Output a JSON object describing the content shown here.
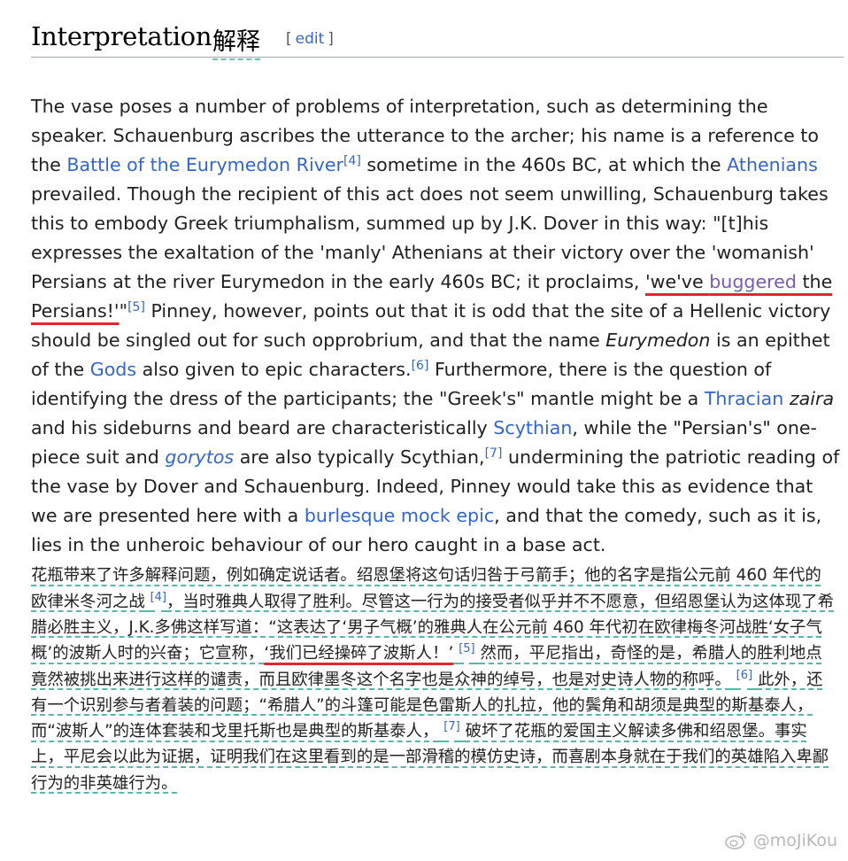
{
  "heading": {
    "title": "Interpretation",
    "title_cn": "解释",
    "edit_open": "[",
    "edit_label": "edit",
    "edit_close": "]"
  },
  "en": {
    "t1": "The vase poses a number of problems of interpretation, such as determining the speaker. Schauenburg ascribes the utterance to the archer; his name is a reference to the ",
    "link_battle": "Battle of the Eurymedon River",
    "ref4": "[4]",
    "t2": " sometime in the 460s BC, at which the ",
    "link_athenians": "Athenians",
    "t3": " prevailed. Though the recipient of this act does not seem unwilling, Schauenburg takes this to embody Greek triumphalism, summed up by J.K. Dover in this way: \"[t]his expresses the exaltation of the 'manly' Athenians at their victory over the 'womanish' Persians at the river Eurymedon in the early 460s BC; it proclaims, ",
    "q1": "'we've ",
    "link_buggered": "buggered",
    "q2": " the Persians!'",
    "t4": "\"",
    "ref5": "[5]",
    "t5": " Pinney, however, points out that it is odd that the site of a Hellenic victory should be singled out for such opprobrium, and that the name ",
    "eurymedon": "Eurymedon",
    "t6": " is an epithet of the ",
    "link_gods": "Gods",
    "t7": " also given to epic characters.",
    "ref6": "[6]",
    "t8": " Furthermore, there is the question of identifying the dress of the participants; the \"Greek's\" mantle might be a ",
    "link_thracian": "Thracian",
    "zaira": "zaira",
    "t9": " and his sideburns and beard are characteristically ",
    "link_scythian": "Scythian",
    "t10": ", while the \"Persian's\" one-piece suit and ",
    "link_gorytos": "gorytos",
    "t11": " are also typically Scythian,",
    "ref7": "[7]",
    "t12": " undermining the patriotic reading of the vase by Dover and Schauenburg. Indeed, Pinney would take this as evidence that we are presented here with a ",
    "link_burlesque": "burlesque",
    "link_mock": "mock epic",
    "t13": ", and that the comedy, such as it is, lies in the unheroic behaviour of our hero caught in a base act."
  },
  "zh": {
    "z1": "花瓶带来了许多解释问题，例如确定说话者。绍恩堡将这句话归咎于弓箭手；他的名字是指公元前 460 年代的欧律米冬河之战",
    "ref4": "[4]",
    "z2": "，当时雅典人取得了胜利。尽管这一行为的接受者似乎并不不愿意，但绍恩堡认为这体现了希腊必胜主义，J.K.多佛这样写道：“这表达了‘男子气概’的雅典人在公元前 460 年代初在欧律梅冬河战胜‘女子气概’的波斯人时的兴奋；它宣称，",
    "zq": "‘我们已经操碎了波斯人！’",
    "ref5": "[5]",
    "z3": "然而，平尼指出，奇怪的是，希腊人的胜利地点竟然被挑出来进行这样的谴责，而且欧律墨冬这个名字也是众神的绰号，也是对史诗人物的称呼。",
    "ref6": "[6]",
    "z4": "此外，还有一个识别参与者着装的问题；“希腊人”的斗篷可能是色雷斯人的扎拉，他的鬓角和胡须是典型的斯基泰人，而“波斯人”的连体套装和戈里托斯也是典型的斯基泰人，",
    "ref7": "[7]",
    "z5": "破坏了花瓶的爱国主义解读多佛和绍恩堡。事实上，平尼会以此为证据，证明我们在这里看到的是一部滑稽的模仿史诗，而喜剧本身就在于我们的英雄陷入卑鄙行为的非英雄行为。"
  },
  "watermark": {
    "text": "@moJiKou",
    "icon": "weibo-icon"
  },
  "colors": {
    "link": "#3366cc",
    "visited_link": "#795cb2",
    "red_underline": "#e3262b",
    "teal_dashed": "#5ab7a8"
  }
}
